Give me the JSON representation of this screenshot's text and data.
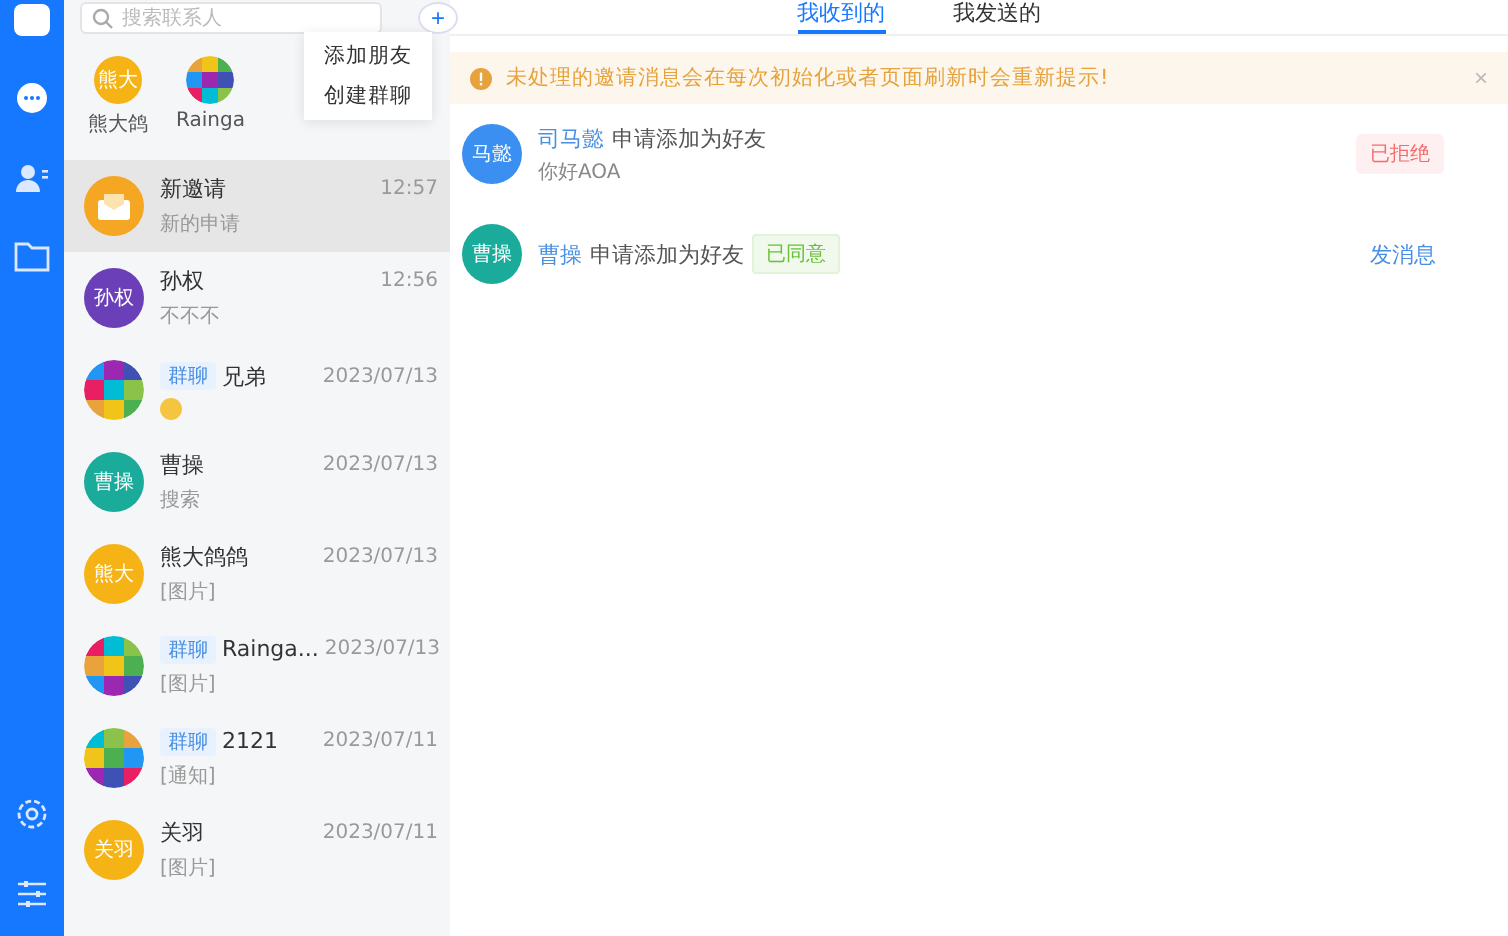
{
  "rail": {
    "items": [
      {
        "kind": "chat",
        "selected": false
      },
      {
        "kind": "contacts",
        "selected": false
      },
      {
        "kind": "folder",
        "selected": false
      }
    ],
    "bottom": [
      {
        "kind": "settings"
      },
      {
        "kind": "sliders"
      }
    ]
  },
  "search": {
    "placeholder": "搜索联系人",
    "add_button": "+"
  },
  "recent": [
    {
      "name": "熊大鸽",
      "avatar_text": "熊大",
      "kind": "person",
      "color": "#f5b316"
    },
    {
      "name": "Rainga",
      "kind": "group"
    }
  ],
  "menu": {
    "items": [
      "添加朋友",
      "创建群聊"
    ]
  },
  "conversations": [
    {
      "kind": "invite",
      "name": "新邀请",
      "time": "12:57",
      "preview": "新的申请",
      "selected": true,
      "color": "#f5a623"
    },
    {
      "kind": "person",
      "avatar_text": "孙权",
      "name": "孙权",
      "time": "12:56",
      "preview": "不不不",
      "selected": false,
      "color": "#6b3fb8"
    },
    {
      "kind": "group",
      "tag": "群聊",
      "name": "兄弟",
      "time": "2023/07/13",
      "preview_emoji": true,
      "selected": false
    },
    {
      "kind": "person",
      "avatar_text": "曹操",
      "name": "曹操",
      "time": "2023/07/13",
      "preview": "搜索",
      "selected": false,
      "color": "#1aab9b"
    },
    {
      "kind": "person",
      "avatar_text": "熊大",
      "name": "熊大鸽鸽",
      "time": "2023/07/13",
      "preview": "[图片]",
      "selected": false,
      "color": "#f5b316"
    },
    {
      "kind": "group",
      "tag": "群聊",
      "name": "Rainga...",
      "time": "2023/07/13",
      "preview": "[图片]",
      "selected": false
    },
    {
      "kind": "group",
      "tag": "群聊",
      "name": "2121",
      "time": "2023/07/11",
      "preview": "[通知]",
      "selected": false
    },
    {
      "kind": "person",
      "avatar_text": "关羽",
      "name": "关羽",
      "time": "2023/07/11",
      "preview": "[图片]",
      "selected": false,
      "color": "#f5b316"
    }
  ],
  "tabs": [
    {
      "label": "我收到的",
      "selected": true
    },
    {
      "label": "我发送的",
      "selected": false
    }
  ],
  "notice": {
    "text": "未处理的邀请消息会在每次初始化或者页面刷新时会重新提示!",
    "close": "×"
  },
  "requests": [
    {
      "avatar_text": "马懿",
      "color": "#3b8ff0",
      "name": "司马懿",
      "action": "申请添加为好友",
      "message": "你好AOA",
      "status": {
        "kind": "rejected",
        "label": "已拒绝"
      }
    },
    {
      "avatar_text": "曹操",
      "color": "#1aab9b",
      "name": "曹操",
      "action": "申请添加为好友",
      "badge": "已同意",
      "status": {
        "kind": "link",
        "label": "发消息"
      }
    }
  ]
}
